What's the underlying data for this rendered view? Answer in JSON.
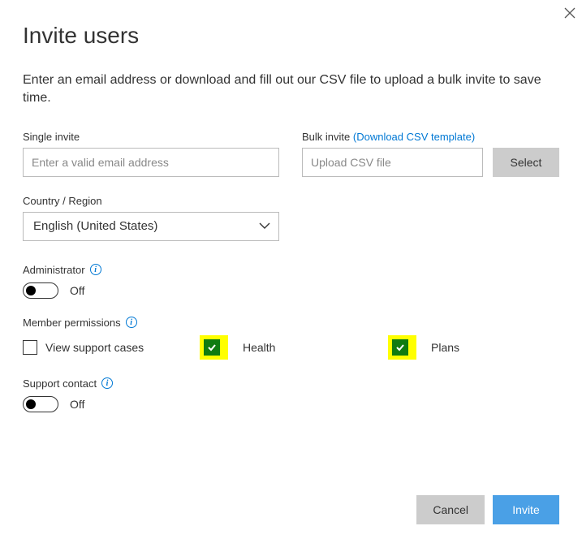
{
  "dialog": {
    "title": "Invite users",
    "description": "Enter an email address or download and fill out our CSV file to upload a bulk invite to save time."
  },
  "single_invite": {
    "label": "Single invite",
    "placeholder": "Enter a valid email address"
  },
  "bulk_invite": {
    "label": "Bulk invite",
    "link_text": "(Download CSV template)",
    "placeholder": "Upload CSV file",
    "select_button": "Select"
  },
  "country_region": {
    "label": "Country / Region",
    "selected": "English (United States)"
  },
  "administrator": {
    "label": "Administrator",
    "state_text": "Off",
    "on": false
  },
  "member_permissions": {
    "label": "Member permissions",
    "options": [
      {
        "label": "View support cases",
        "checked": false,
        "highlighted": false
      },
      {
        "label": "Health",
        "checked": true,
        "highlighted": true
      },
      {
        "label": "Plans",
        "checked": true,
        "highlighted": true
      }
    ]
  },
  "support_contact": {
    "label": "Support contact",
    "state_text": "Off",
    "on": false
  },
  "footer": {
    "cancel": "Cancel",
    "invite": "Invite"
  }
}
